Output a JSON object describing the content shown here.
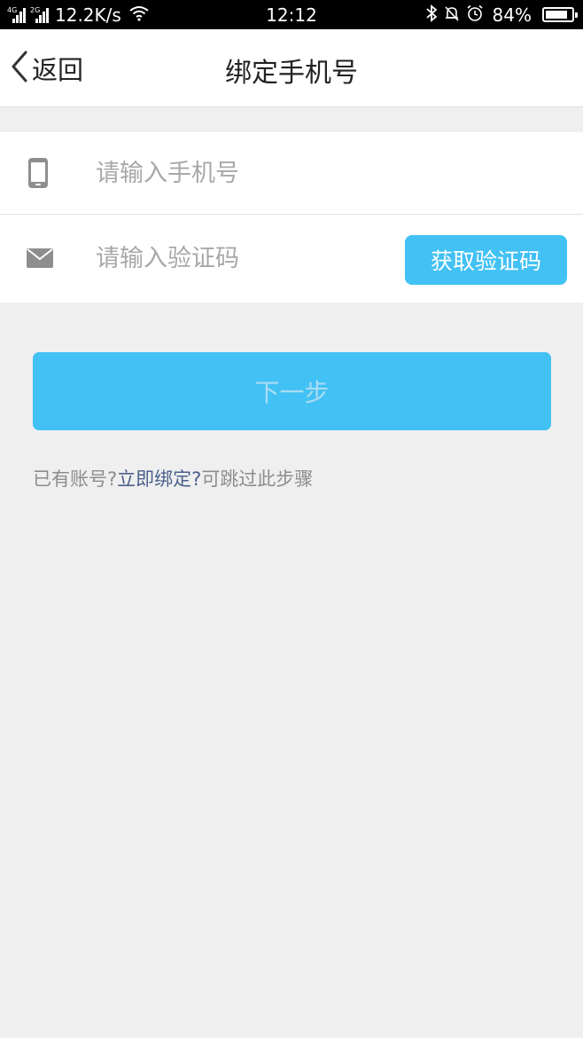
{
  "status_bar": {
    "net_left": "4G",
    "net_right": "2G",
    "speed": "12.2K/s",
    "time": "12:12",
    "battery": "84%",
    "battery_level": 0.84,
    "icons": [
      "signal-icon",
      "wifi-icon",
      "bluetooth-icon",
      "mute-bell-icon",
      "alarm-icon",
      "battery-icon"
    ]
  },
  "nav": {
    "back_label": "返回",
    "title": "绑定手机号"
  },
  "form": {
    "phone_placeholder": "请输入手机号",
    "phone_value": "",
    "code_placeholder": "请输入验证码",
    "code_value": "",
    "get_code_label": "获取验证码"
  },
  "next_label": "下一步",
  "hint": {
    "prefix": "已有账号?",
    "link": "立即绑定?",
    "suffix": "可跳过此步骤"
  },
  "colors": {
    "accent": "#42c1f4",
    "link": "#4a5f8c",
    "background": "#efefef"
  }
}
